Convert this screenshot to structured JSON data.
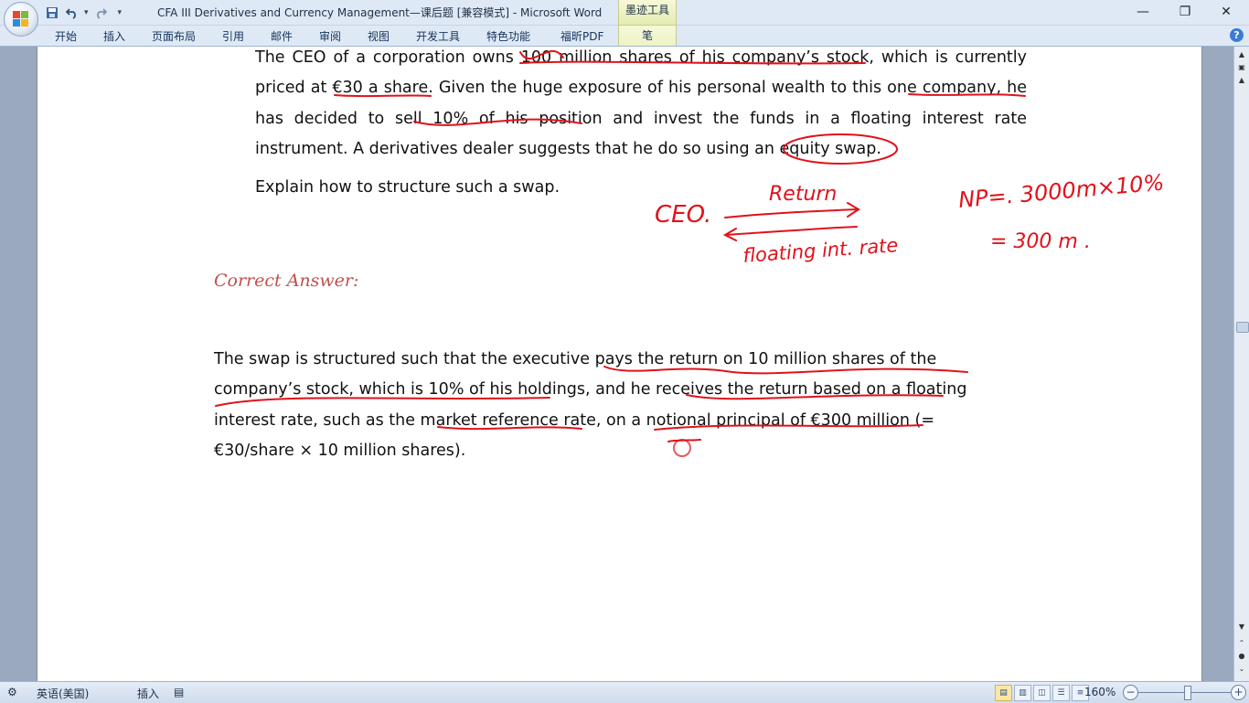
{
  "window": {
    "title": "CFA III Derivatives and Currency Management—课后题 [兼容模式] - Microsoft Word",
    "ink_tools_context": "墨迹工具",
    "minimize_label": "—",
    "restore_label": "❐",
    "close_label": "✕"
  },
  "quick_access": {
    "save_icon": "save-icon",
    "undo_icon": "undo-icon",
    "redo_icon": "redo-icon"
  },
  "ribbon": {
    "tabs": [
      {
        "label": "开始"
      },
      {
        "label": "插入"
      },
      {
        "label": "页面布局"
      },
      {
        "label": "引用"
      },
      {
        "label": "邮件"
      },
      {
        "label": "审阅"
      },
      {
        "label": "视图"
      },
      {
        "label": "开发工具"
      },
      {
        "label": "特色功能"
      },
      {
        "label": "福昕PDF"
      },
      {
        "label": "笔"
      }
    ],
    "help": "?"
  },
  "document": {
    "question_paragraph": "The CEO of a corporation owns 100 million shares of his company’s stock, which is currently priced at €30 a share. Given the huge exposure of his personal wealth to this one company, he has decided to sell 10% of his position and invest the funds in a floating interest rate instrument. A derivatives dealer suggests that he do so using an equity swap.",
    "question_prompt": "Explain how to structure such a swap.",
    "answer_heading": "Correct Answer:",
    "answer_paragraph": "The swap is structured such that the executive pays the return on 10 million shares of the company’s stock, which is 10% of his holdings, and he receives the return based on a floating interest rate, such as the market reference rate, on a notional principal of €300 million (= €30/share × 10 million shares)."
  },
  "ink": {
    "ceo": "CEO.",
    "return": "Return",
    "floating": "floating int. rate",
    "np_line1": "NP=. 3000m×10%",
    "np_line2": "= 300 m .",
    "color": "#e0121b"
  },
  "statusbar": {
    "language": "英语(美国)",
    "insert_mode": "插入",
    "zoom": "160%"
  }
}
